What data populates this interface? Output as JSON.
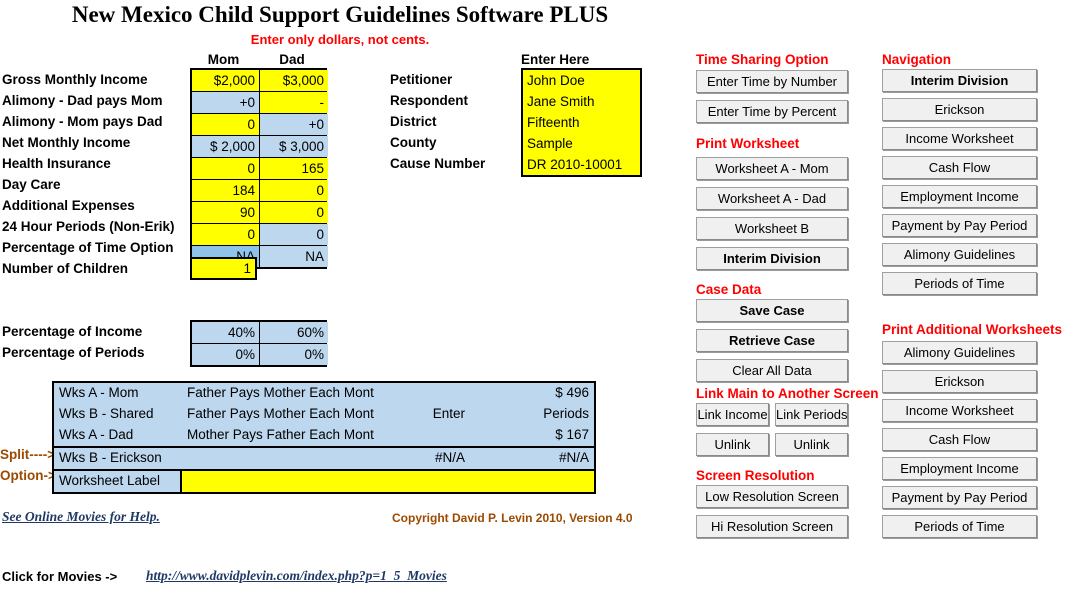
{
  "title": "New Mexico Child Support Guidelines Software PLUS",
  "subtitle": "Enter only dollars, not cents.",
  "income": {
    "col_mom": "Mom",
    "col_dad": "Dad",
    "rows": [
      {
        "label": "Gross Monthly Income",
        "mom": "$2,000",
        "mom_style": "yellow",
        "dad": "$3,000",
        "dad_style": "yellow"
      },
      {
        "label": "Alimony - Dad pays Mom",
        "mom": "+0",
        "mom_style": "blue",
        "dad": "-",
        "dad_style": "yellow"
      },
      {
        "label": "Alimony - Mom pays Dad",
        "mom": "0",
        "mom_style": "yellow",
        "dad": "+0",
        "dad_style": "blue"
      },
      {
        "label": "Net Monthly Income",
        "mom": "$ 2,000",
        "mom_style": "blue",
        "dad": "$ 3,000",
        "dad_style": "blue"
      },
      {
        "label": "Health Insurance",
        "mom": "0",
        "mom_style": "yellow",
        "dad": "165",
        "dad_style": "yellow"
      },
      {
        "label": "Day Care",
        "mom": "184",
        "mom_style": "yellow",
        "dad": "0",
        "dad_style": "yellow"
      },
      {
        "label": "Additional Expenses",
        "mom": "90",
        "mom_style": "yellow",
        "dad": "0",
        "dad_style": "yellow"
      },
      {
        "label": "24 Hour Periods (Non-Erik)",
        "mom": "0",
        "mom_style": "yellow",
        "dad": "0",
        "dad_style": "blue"
      },
      {
        "label": "Percentage of Time Option",
        "mom": "NA",
        "mom_style": "blue2",
        "dad": "NA",
        "dad_style": "blue"
      }
    ],
    "children_label": "Number of Children",
    "children_value": "1"
  },
  "percentages": {
    "rows": [
      {
        "label": "Percentage of Income",
        "mom": "40%",
        "dad": "60%"
      },
      {
        "label": "Percentage of Periods",
        "mom": "0%",
        "dad": "0%"
      }
    ]
  },
  "case_info": {
    "header": "Enter Here",
    "rows": [
      {
        "label": "Petitioner",
        "value": "John Doe"
      },
      {
        "label": "Respondent",
        "value": "Jane Smith"
      },
      {
        "label": "District",
        "value": "Fifteenth"
      },
      {
        "label": "County",
        "value": "Sample"
      },
      {
        "label": "Cause Number",
        "value": "DR 2010-10001"
      }
    ]
  },
  "summary": {
    "split_label": "Split---->",
    "option_label": "Option->",
    "rows": [
      {
        "name": "Wks A - Mom",
        "desc": "Father Pays Mother Each Month",
        "mid": "",
        "amount": "$ 496"
      },
      {
        "name": "Wks B - Shared",
        "desc": "Father Pays Mother Each Month",
        "mid": "Enter",
        "amount": "Periods"
      },
      {
        "name": "Wks A - Dad",
        "desc": "Mother Pays Father Each Month",
        "mid": "",
        "amount": "$ 167"
      },
      {
        "name": "Wks B - Erickson",
        "desc": "",
        "mid": "#N/A",
        "amount": "#N/A"
      }
    ],
    "worksheet_label": "Worksheet Label",
    "worksheet_value": ""
  },
  "time_sharing": {
    "heading": "Time Sharing Option",
    "buttons": [
      "Enter Time by Number",
      "Enter Time by Percent"
    ]
  },
  "print_worksheet": {
    "heading": "Print Worksheet",
    "buttons": [
      "Worksheet A - Mom",
      "Worksheet A - Dad",
      "Worksheet B",
      "Interim Division"
    ]
  },
  "case_data": {
    "heading": "Case Data",
    "buttons": [
      "Save Case",
      "Retrieve Case",
      "Clear All Data"
    ]
  },
  "link_screen": {
    "heading": "Link Main to Another Screen",
    "buttons": [
      "Link Income",
      "Link Periods",
      "Unlink",
      "Unlink"
    ]
  },
  "screen_resolution": {
    "heading": "Screen Resolution",
    "buttons": [
      "Low Resolution Screen",
      "Hi Resolution Screen"
    ]
  },
  "navigation": {
    "heading": "Navigation",
    "buttons": [
      "Interim Division",
      "Erickson",
      "Income Worksheet",
      "Cash Flow",
      "Employment Income",
      "Payment by Pay Period",
      "Alimony Guidelines",
      "Periods of Time"
    ]
  },
  "print_additional": {
    "heading": "Print Additional Worksheets",
    "buttons": [
      "Alimony Guidelines",
      "Erickson",
      "Income Worksheet",
      "Cash Flow",
      "Employment Income",
      "Payment by Pay Period",
      "Periods of Time"
    ]
  },
  "footer": {
    "movies_link": "See Online Movies for Help.",
    "copyright": "Copyright David P. Levin 2010, Version 4.0",
    "click_label": "Click for Movies ->",
    "url": "http://www.davidplevin.com/index.php?p=1_5_Movies"
  },
  "colors": {
    "accent_red": "#ff0000",
    "accent_brown": "#9c4a00",
    "input_yellow": "#ffff00",
    "computed_blue": "#bdd7ee",
    "link_navy": "#1f3864"
  }
}
